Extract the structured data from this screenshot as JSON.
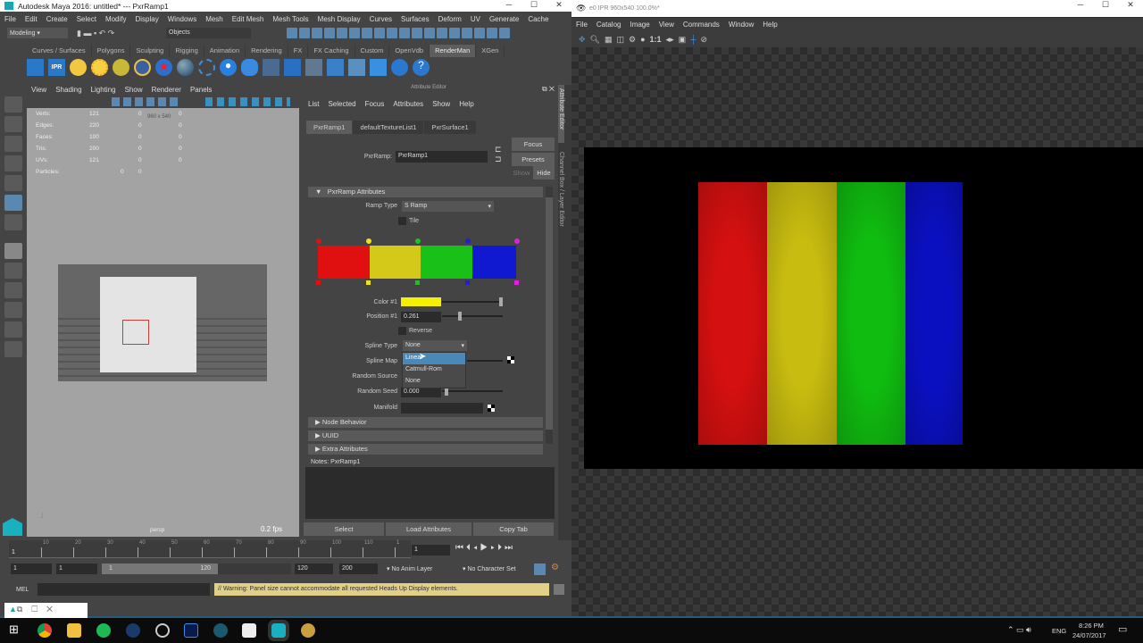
{
  "maya": {
    "title": "Autodesk Maya 2016: untitled*  ---  PxrRamp1",
    "menu": [
      "File",
      "Edit",
      "Create",
      "Select",
      "Modify",
      "Display",
      "Windows",
      "Mesh",
      "Edit Mesh",
      "Mesh Tools",
      "Mesh Display",
      "Curves",
      "Surfaces",
      "Deform",
      "UV",
      "Generate",
      "Cache"
    ],
    "mode_select": "Modeling",
    "objects_field": "Objects",
    "shelf_tabs": [
      "Curves / Surfaces",
      "Polygons",
      "Sculpting",
      "Rigging",
      "Animation",
      "Rendering",
      "FX",
      "FX Caching",
      "Custom",
      "OpenVdb",
      "RenderMan",
      "XGen"
    ],
    "active_shelf": "RenderMan",
    "ipr_icon_label": "IPR",
    "viewport": {
      "menu": [
        "View",
        "Shading",
        "Lighting",
        "Show",
        "Renderer",
        "Panels"
      ],
      "hud": [
        [
          "Verts:",
          "121",
          "0",
          "0"
        ],
        [
          "Edges:",
          "220",
          "0",
          "0"
        ],
        [
          "Faces:",
          "100",
          "0",
          "0"
        ],
        [
          "Tris:",
          "200",
          "0",
          "0"
        ],
        [
          "UVs:",
          "121",
          "0",
          "0"
        ]
      ],
      "particles": [
        "Particles:",
        "0",
        "0"
      ],
      "resolution": "960 x 540",
      "camera": "persp",
      "fps": "0.2 fps"
    },
    "attribute_editor": {
      "title": "Attribute Editor",
      "menu": [
        "List",
        "Selected",
        "Focus",
        "Attributes",
        "Show",
        "Help"
      ],
      "tabs": [
        "PxrRamp1",
        "defaultTextureList1",
        "PxrSurface1"
      ],
      "node_label": "PxrRamp:",
      "node_name": "PxrRamp1",
      "focus": "Focus",
      "presets": "Presets",
      "show": "Show",
      "hide": "Hide",
      "section": "PxrRamp Attributes",
      "ramp_type_label": "Ramp Type",
      "ramp_type": "S Ramp",
      "tile": "Tile",
      "ramp_colors": [
        "#e01010",
        "#d4c818",
        "#18c018",
        "#1018d0"
      ],
      "ramp_markers": [
        "#e01010",
        "#f0e020",
        "#20c020",
        "#2020d0",
        "#e020e0"
      ],
      "color_label": "Color #1",
      "color_value": "#f5f000",
      "position_label": "Position #1",
      "position_value": "0.261",
      "reverse": "Reverse",
      "spline_type_label": "Spline Type",
      "spline_type": "None",
      "spline_options": [
        "Linear",
        "Catmull-Rom",
        "None"
      ],
      "spline_map_label": "Spline Map",
      "random_source_label": "Random Source",
      "random_seed_label": "Random Seed",
      "random_seed": "0.000",
      "manifold_label": "Manifold",
      "collapsed_sections": [
        "Node Behavior",
        "UUID",
        "Extra Attributes"
      ],
      "notes_label": "Notes:  PxrRamp1",
      "buttons": [
        "Select",
        "Load Attributes",
        "Copy Tab"
      ],
      "side_tabs": [
        "Attribute Editor",
        "Channel Box / Layer Editor"
      ]
    },
    "timeline": {
      "ticks": [
        "10",
        "20",
        "30",
        "40",
        "50",
        "60",
        "70",
        "80",
        "90",
        "100",
        "110",
        "1"
      ],
      "current_frame": "1",
      "start": "1",
      "playback_start": "1",
      "range_start": "1",
      "range_end": "120",
      "playback_end": "120",
      "end": "200",
      "anim_layer": "No Anim Layer",
      "character_set": "No Character Set"
    },
    "command_line": {
      "label": "MEL",
      "warning": "// Warning: Panel size cannot accommodate all requested Heads Up Display elements."
    }
  },
  "ipr": {
    "title": "e0 IPR 960x540 100.0%*",
    "menu": [
      "File",
      "Catalog",
      "Image",
      "View",
      "Commands",
      "Window",
      "Help"
    ],
    "one_to_one": "1:1",
    "stripes": [
      "#d41010",
      "#c8bc10",
      "#10bc10",
      "#0a10c0"
    ]
  },
  "taskbar": {
    "lang": "ENG",
    "time": "8:26 PM",
    "date": "24/07/2017"
  }
}
